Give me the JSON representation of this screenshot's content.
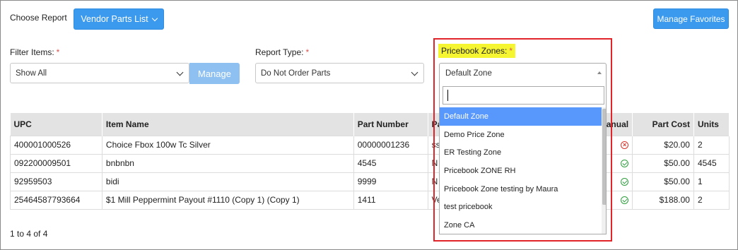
{
  "header": {
    "choose_report_label": "Choose Report",
    "report_button_label": "Vendor Parts List",
    "manage_favorites_label": "Manage Favorites"
  },
  "filters": {
    "filter_items_label": "Filter Items:",
    "filter_items_value": "Show All",
    "manage_label": "Manage",
    "report_type_label": "Report Type:",
    "report_type_value": "Do Not Order Parts",
    "pricebook_zones_label": "Pricebook Zones:",
    "pricebook_zones_value": "Default Zone",
    "required_mark": "*"
  },
  "table": {
    "headers": [
      "UPC",
      "Item Name",
      "Part Number",
      "Pa",
      "anual",
      "Part Cost",
      "Units"
    ],
    "rows": [
      {
        "upc": "400001000526",
        "item_name": "Choice Fbox 100w Tc Silver",
        "part_number": "00000001236",
        "pa": "ss",
        "manual": "x-circle-icon",
        "part_cost": "$20.00",
        "units": "2"
      },
      {
        "upc": "092200009501",
        "item_name": "bnbnbn",
        "part_number": "4545",
        "pa": "N",
        "manual": "check-circle-icon",
        "part_cost": "$50.00",
        "units": "4545"
      },
      {
        "upc": "92959503",
        "item_name": "bidi",
        "part_number": "9999",
        "pa": "N",
        "manual": "check-circle-icon",
        "part_cost": "$50.00",
        "units": "1"
      },
      {
        "upc": "25464587793664",
        "item_name": "$1 Mill Peppermint Payout #1110 (Copy 1) (Copy 1)",
        "part_number": "1411",
        "pa": "Ve",
        "manual": "check-circle-icon",
        "part_cost": "$188.00",
        "units": "2"
      }
    ]
  },
  "paging": {
    "text": "1 to 4 of 4"
  },
  "dropdown": {
    "search_value": "",
    "options": [
      "Default Zone",
      "Demo Price Zone",
      "ER Testing Zone",
      "Pricebook ZONE RH",
      "Pricebook Zone testing by Maura",
      "test pricebook",
      "Zone CA"
    ],
    "selected_index": 0
  },
  "colors": {
    "primary": "#3b99ee",
    "highlight_box": "#e0242a",
    "label_highlight": "#f5f531",
    "option_active": "#5897fb"
  }
}
